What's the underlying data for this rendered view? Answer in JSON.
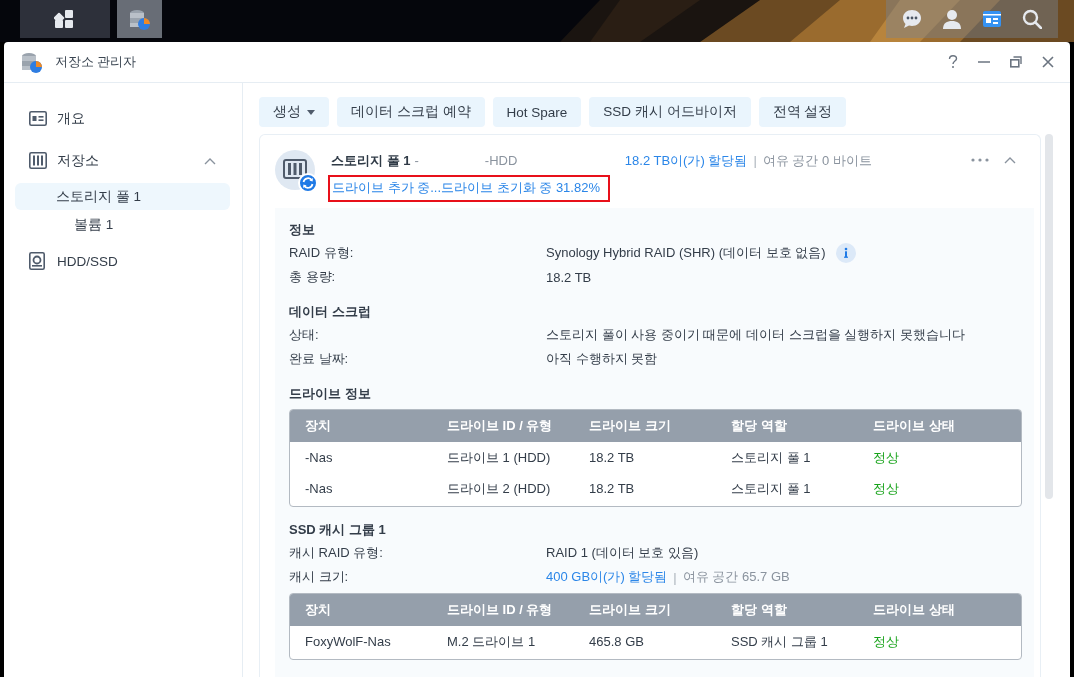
{
  "taskbar": {
    "apps": [
      {
        "selected": false
      },
      {
        "selected": true
      }
    ],
    "tray": [
      {
        "selected": false
      },
      {
        "selected": false
      },
      {
        "selected": true
      },
      {
        "selected": false
      }
    ]
  },
  "window": {
    "title": "저장소 관리자"
  },
  "sidebar": {
    "items": [
      {
        "label": "개요",
        "selected": false
      },
      {
        "label": "저장소",
        "selected": false,
        "expanded": true,
        "children": [
          {
            "label": "스토리지 풀 1",
            "selected": true,
            "children": [
              {
                "label": "볼륨 1",
                "selected": false
              }
            ]
          }
        ]
      },
      {
        "label": "HDD/SSD",
        "selected": false
      }
    ]
  },
  "toolbar": [
    {
      "label": "생성",
      "dropdown": true
    },
    {
      "label": "데이터 스크럽 예약",
      "dropdown": false
    },
    {
      "label": "Hot Spare",
      "dropdown": false
    },
    {
      "label": "SSD 캐시 어드바이저",
      "dropdown": false
    },
    {
      "label": "전역 설정",
      "dropdown": false
    }
  ],
  "pool": {
    "name": "스토리지 풀 1",
    "name_suffix": "-",
    "type": "-HDD",
    "allocated": "18.2 TB이(가) 할당됨",
    "separator": "|",
    "free": "여유 공간 0 바이트",
    "status": "드라이브 추가 중...드라이브 초기화 중 31.82%",
    "highlighted": true,
    "expanded": true
  },
  "sections": [
    {
      "title": "정보",
      "fields": [
        {
          "label": "RAID 유형:",
          "value": "Synology Hybrid RAID (SHR) (데이터 보호 없음)",
          "accent": false,
          "info": true
        },
        {
          "label": "총 용량:",
          "value": "18.2 TB",
          "accent": false,
          "info": false
        }
      ]
    },
    {
      "title": "데이터 스크럽",
      "fields": [
        {
          "label": "상태:",
          "value": "스토리지 풀이 사용 중이기 때문에 데이터 스크럽을 실행하지 못했습니다",
          "accent": false,
          "info": false
        },
        {
          "label": "완료 날짜:",
          "value": "아직 수행하지 못함",
          "accent": false,
          "info": false
        }
      ]
    },
    {
      "title": "드라이브 정보",
      "table": {
        "columns": [
          "장치",
          "드라이브 ID / 유형",
          "드라이브 크기",
          "할당 역할",
          "드라이브 상태"
        ],
        "rows": [
          {
            "device": "-Nas",
            "drive": "드라이브 1 (HDD)",
            "size": "18.2 TB",
            "role": "스토리지 풀 1",
            "status": "정상",
            "healthy": true
          },
          {
            "device": "-Nas",
            "drive": "드라이브 2 (HDD)",
            "size": "18.2 TB",
            "role": "스토리지 풀 1",
            "status": "정상",
            "healthy": true
          }
        ]
      }
    },
    {
      "title": "SSD 캐시 그룹 1",
      "fields": [
        {
          "label": "캐시 RAID 유형:",
          "value": "RAID 1 (데이터 보호 있음)",
          "accent": false,
          "info": false
        },
        {
          "label": "캐시 크기:",
          "value": "400 GB이(가) 할당됨",
          "accent": true,
          "info": false,
          "separator": "|",
          "note": "여유 공간 65.7 GB"
        }
      ],
      "table": {
        "columns": [
          "장치",
          "드라이브 ID / 유형",
          "드라이브 크기",
          "할당 역할",
          "드라이브 상태"
        ],
        "rows": [
          {
            "device": "FoxyWolF-Nas",
            "drive": "M.2 드라이브 1",
            "size": "465.8 GB",
            "role": "SSD 캐시 그룹 1",
            "status": "정상",
            "healthy": true
          }
        ]
      }
    }
  ]
}
